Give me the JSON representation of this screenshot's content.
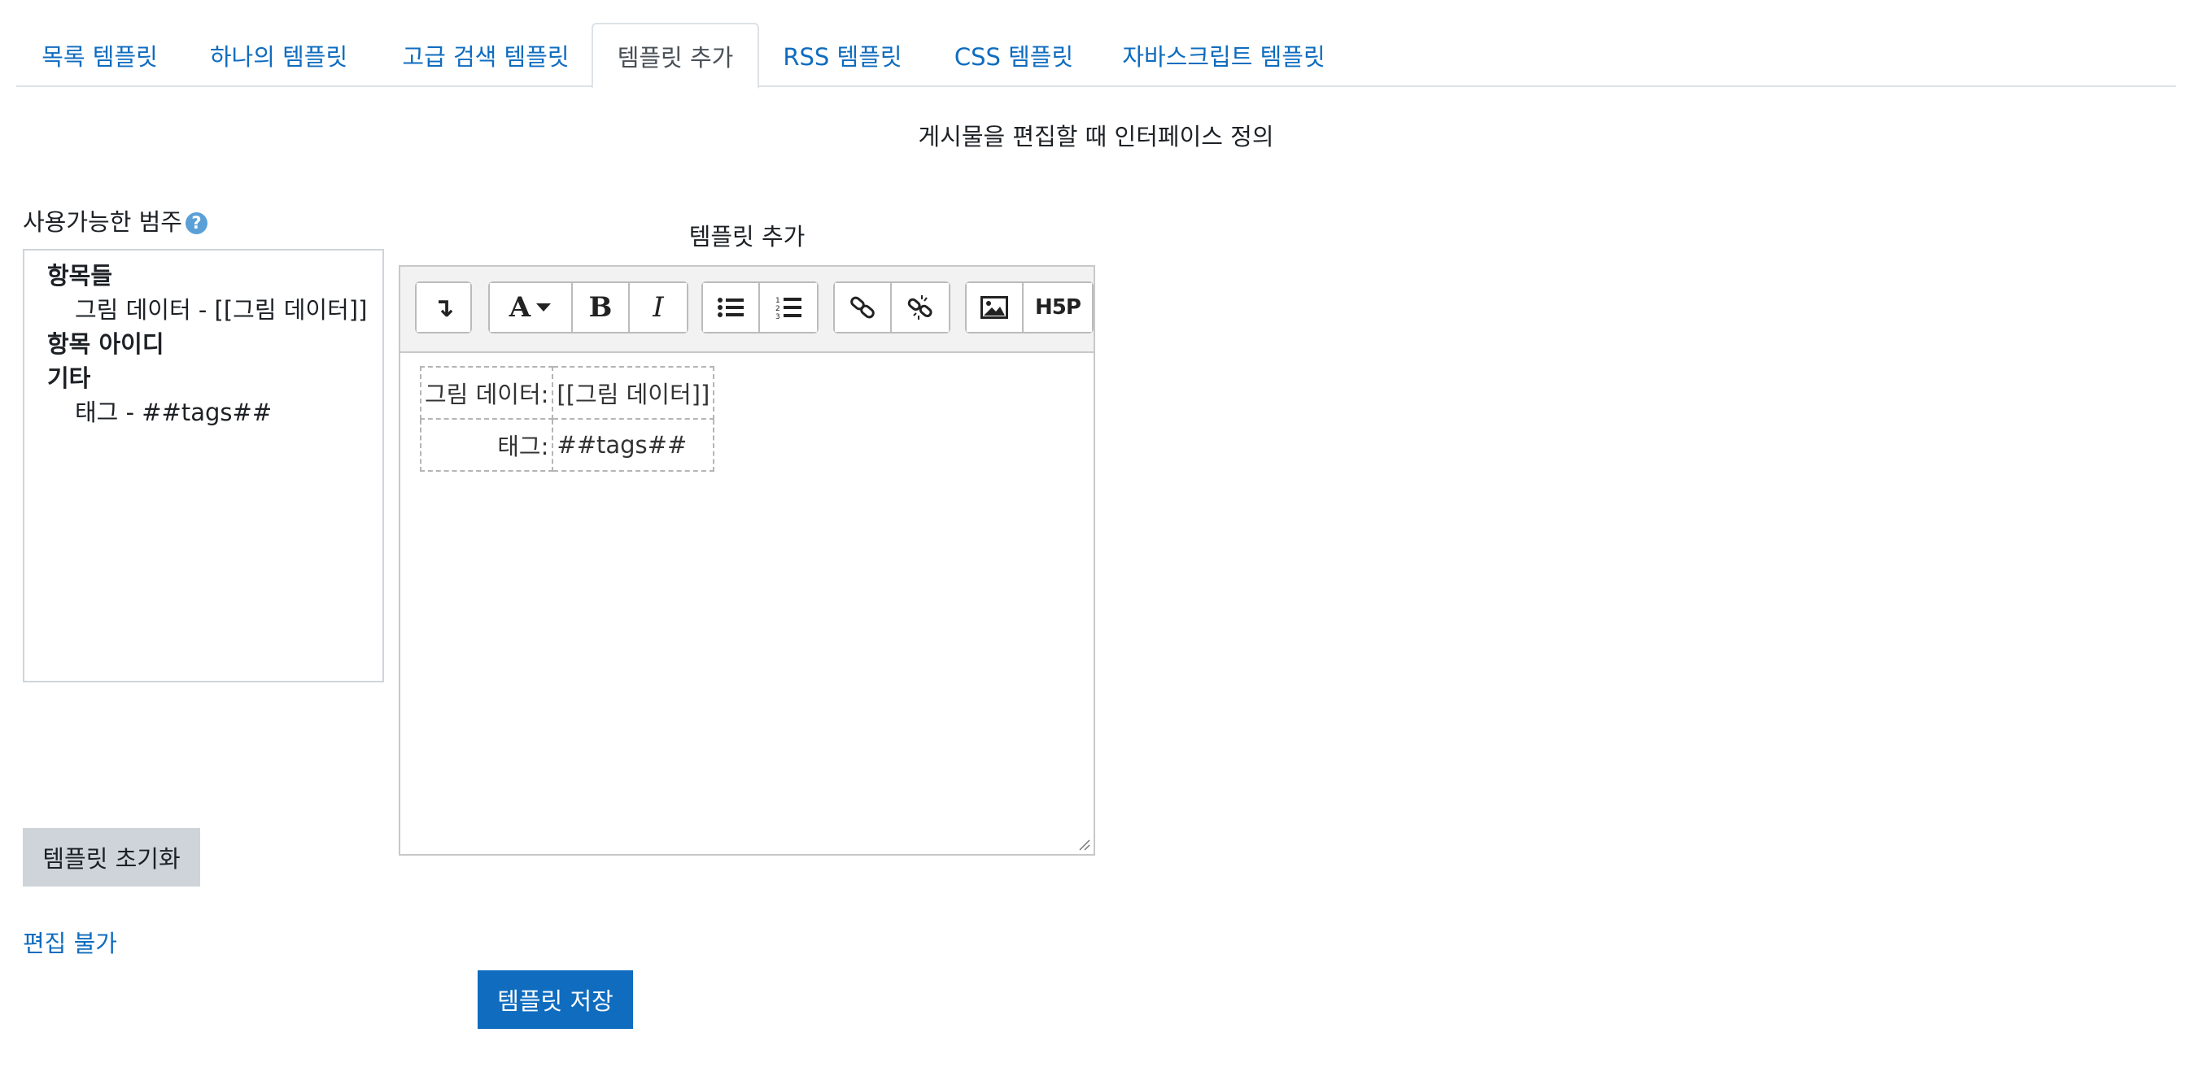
{
  "tabs": [
    {
      "label": "목록 템플릿"
    },
    {
      "label": "하나의 템플릿"
    },
    {
      "label": "고급 검색 템플릿"
    },
    {
      "label": "템플릿 추가",
      "active": true
    },
    {
      "label": "RSS 템플릿"
    },
    {
      "label": "CSS 템플릿"
    },
    {
      "label": "자바스크립트 템플릿"
    }
  ],
  "description": "게시물을 편집할 때 인터페이스 정의",
  "categories": {
    "label": "사용가능한 범주",
    "help_icon": "?",
    "groups": [
      {
        "title": "항목들",
        "items": [
          "그림 데이터 - [[그림 데이터]]"
        ]
      },
      {
        "title": "항목 아이디",
        "items": []
      },
      {
        "title": "기타",
        "items": [
          "태그 - ##tags##"
        ]
      }
    ]
  },
  "editor": {
    "label": "템플릿 추가",
    "toolbar": {
      "collapse": "↴",
      "font_color": "A",
      "bold": "B",
      "italic": "I",
      "h5p": "H5P"
    },
    "rows": [
      {
        "label": "그림 데이터:",
        "value": "[[그림 데이터]]"
      },
      {
        "label": "태그:",
        "value": "##tags##"
      }
    ]
  },
  "buttons": {
    "reset": "템플릿 초기화",
    "noedit": "편집 불가",
    "save": "템플릿 저장"
  },
  "colors": {
    "link": "#0f6cbf",
    "primary": "#0f6cbf",
    "secondary": "#ced4da",
    "help": "#5aa0d6"
  }
}
